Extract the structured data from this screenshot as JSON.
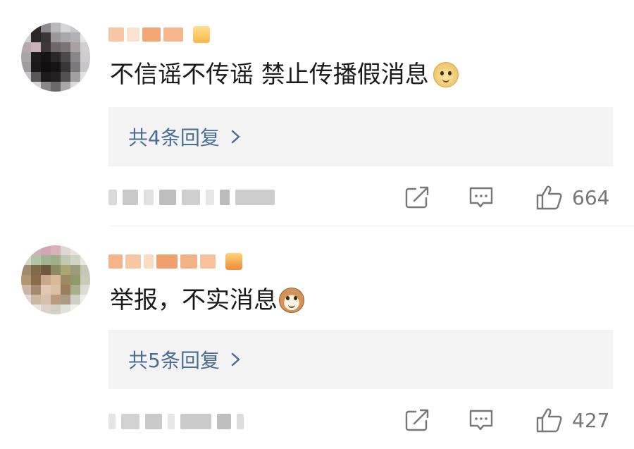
{
  "comments": [
    {
      "text": "不信谣不传谣 禁止传播假消息",
      "emoji": "doge-emoji",
      "replies_label": "共4条回复",
      "likes": "664"
    },
    {
      "text": "举报，不实消息",
      "emoji": "cat-emoji",
      "replies_label": "共5条回复",
      "likes": "427"
    }
  ],
  "icons": {
    "share": "share-icon",
    "comment": "comment-icon",
    "like": "thumbs-up-icon",
    "chevron": "chevron-right-icon"
  },
  "colors": {
    "reply_text": "#4a6d96",
    "reply_bg": "#f3f3f3",
    "meta_text": "#777777"
  }
}
